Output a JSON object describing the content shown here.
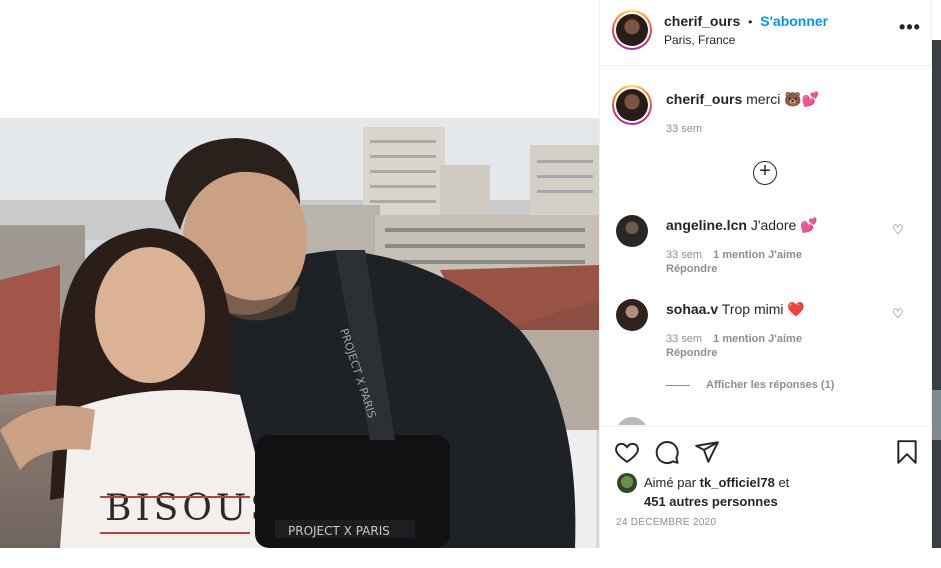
{
  "post": {
    "username": "cherif_ours",
    "separator": "•",
    "follow_label": "S'abonner",
    "location": "Paris, France",
    "more_icon": "more-horizontal-icon",
    "more_glyph": "•••"
  },
  "caption": {
    "username": "cherif_ours",
    "text": "merci 🐻💕",
    "time": "33 sem"
  },
  "load_more_icon": "plus-circle-icon",
  "load_more_glyph": "+",
  "comments": [
    {
      "username": "angeline.lcn",
      "text": "J'adore 💕",
      "time": "33 sem",
      "likes": "1 mention J'aime",
      "reply": "Répondre",
      "avatar_color": "#2a2624"
    },
    {
      "username": "sohaa.v",
      "text": "Trop mimi ❤️",
      "time": "33 sem",
      "likes": "1 mention J'aime",
      "reply": "Répondre",
      "avatar_color": "#3b2d2a",
      "replies_label": "Afficher les réponses (1)"
    }
  ],
  "comment_like_glyph": "♡",
  "actions": {
    "like_icon": "heart-icon",
    "comment_icon": "comment-icon",
    "share_icon": "paper-plane-icon",
    "save_icon": "bookmark-icon"
  },
  "likes": {
    "prefix": "Aimé par",
    "user": "tk_officiel78",
    "conjunction": "et",
    "others": "451 autres personnes"
  },
  "date": "24 DÉCEMBRE 2020",
  "colors": {
    "link_blue": "#0095f6",
    "text": "#262626",
    "muted": "#8e8e8e",
    "heart_red": "#ed4956"
  }
}
